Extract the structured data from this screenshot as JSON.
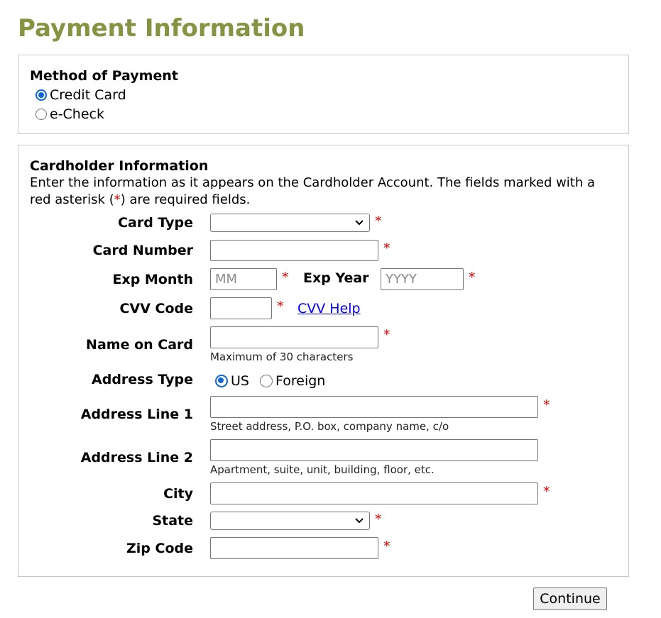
{
  "page_title": "Payment Information",
  "method": {
    "heading": "Method of Payment",
    "options": [
      {
        "label": "Credit Card",
        "checked": true
      },
      {
        "label": "e-Check",
        "checked": false
      }
    ]
  },
  "cardholder": {
    "heading": "Cardholder Information",
    "intro_before": "Enter the information as it appears on the Cardholder Account. The fields marked with a red asterisk (",
    "intro_star": "*",
    "intro_after": ") are required fields.",
    "required_mark": "*",
    "fields": {
      "card_type": {
        "label": "Card Type",
        "value": ""
      },
      "card_number": {
        "label": "Card Number",
        "value": ""
      },
      "exp_month": {
        "label": "Exp Month",
        "placeholder": "MM"
      },
      "exp_year": {
        "label": "Exp Year",
        "placeholder": "YYYY"
      },
      "cvv": {
        "label": "CVV Code",
        "help_link": "CVV Help"
      },
      "name_on_card": {
        "label": "Name on Card",
        "hint": "Maximum of 30 characters"
      },
      "address_type": {
        "label": "Address Type",
        "options": [
          {
            "label": "US",
            "checked": true
          },
          {
            "label": "Foreign",
            "checked": false
          }
        ]
      },
      "address1": {
        "label": "Address Line 1",
        "hint": "Street address, P.O. box, company name, c/o"
      },
      "address2": {
        "label": "Address Line 2",
        "hint": "Apartment, suite, unit, building, floor, etc."
      },
      "city": {
        "label": "City"
      },
      "state": {
        "label": "State",
        "value": ""
      },
      "zip": {
        "label": "Zip Code"
      }
    }
  },
  "actions": {
    "continue_label": "Continue"
  },
  "colors": {
    "title": "#849443",
    "required": "#e00000",
    "link": "#0000ee",
    "radio_selected": "#0a66d9"
  }
}
